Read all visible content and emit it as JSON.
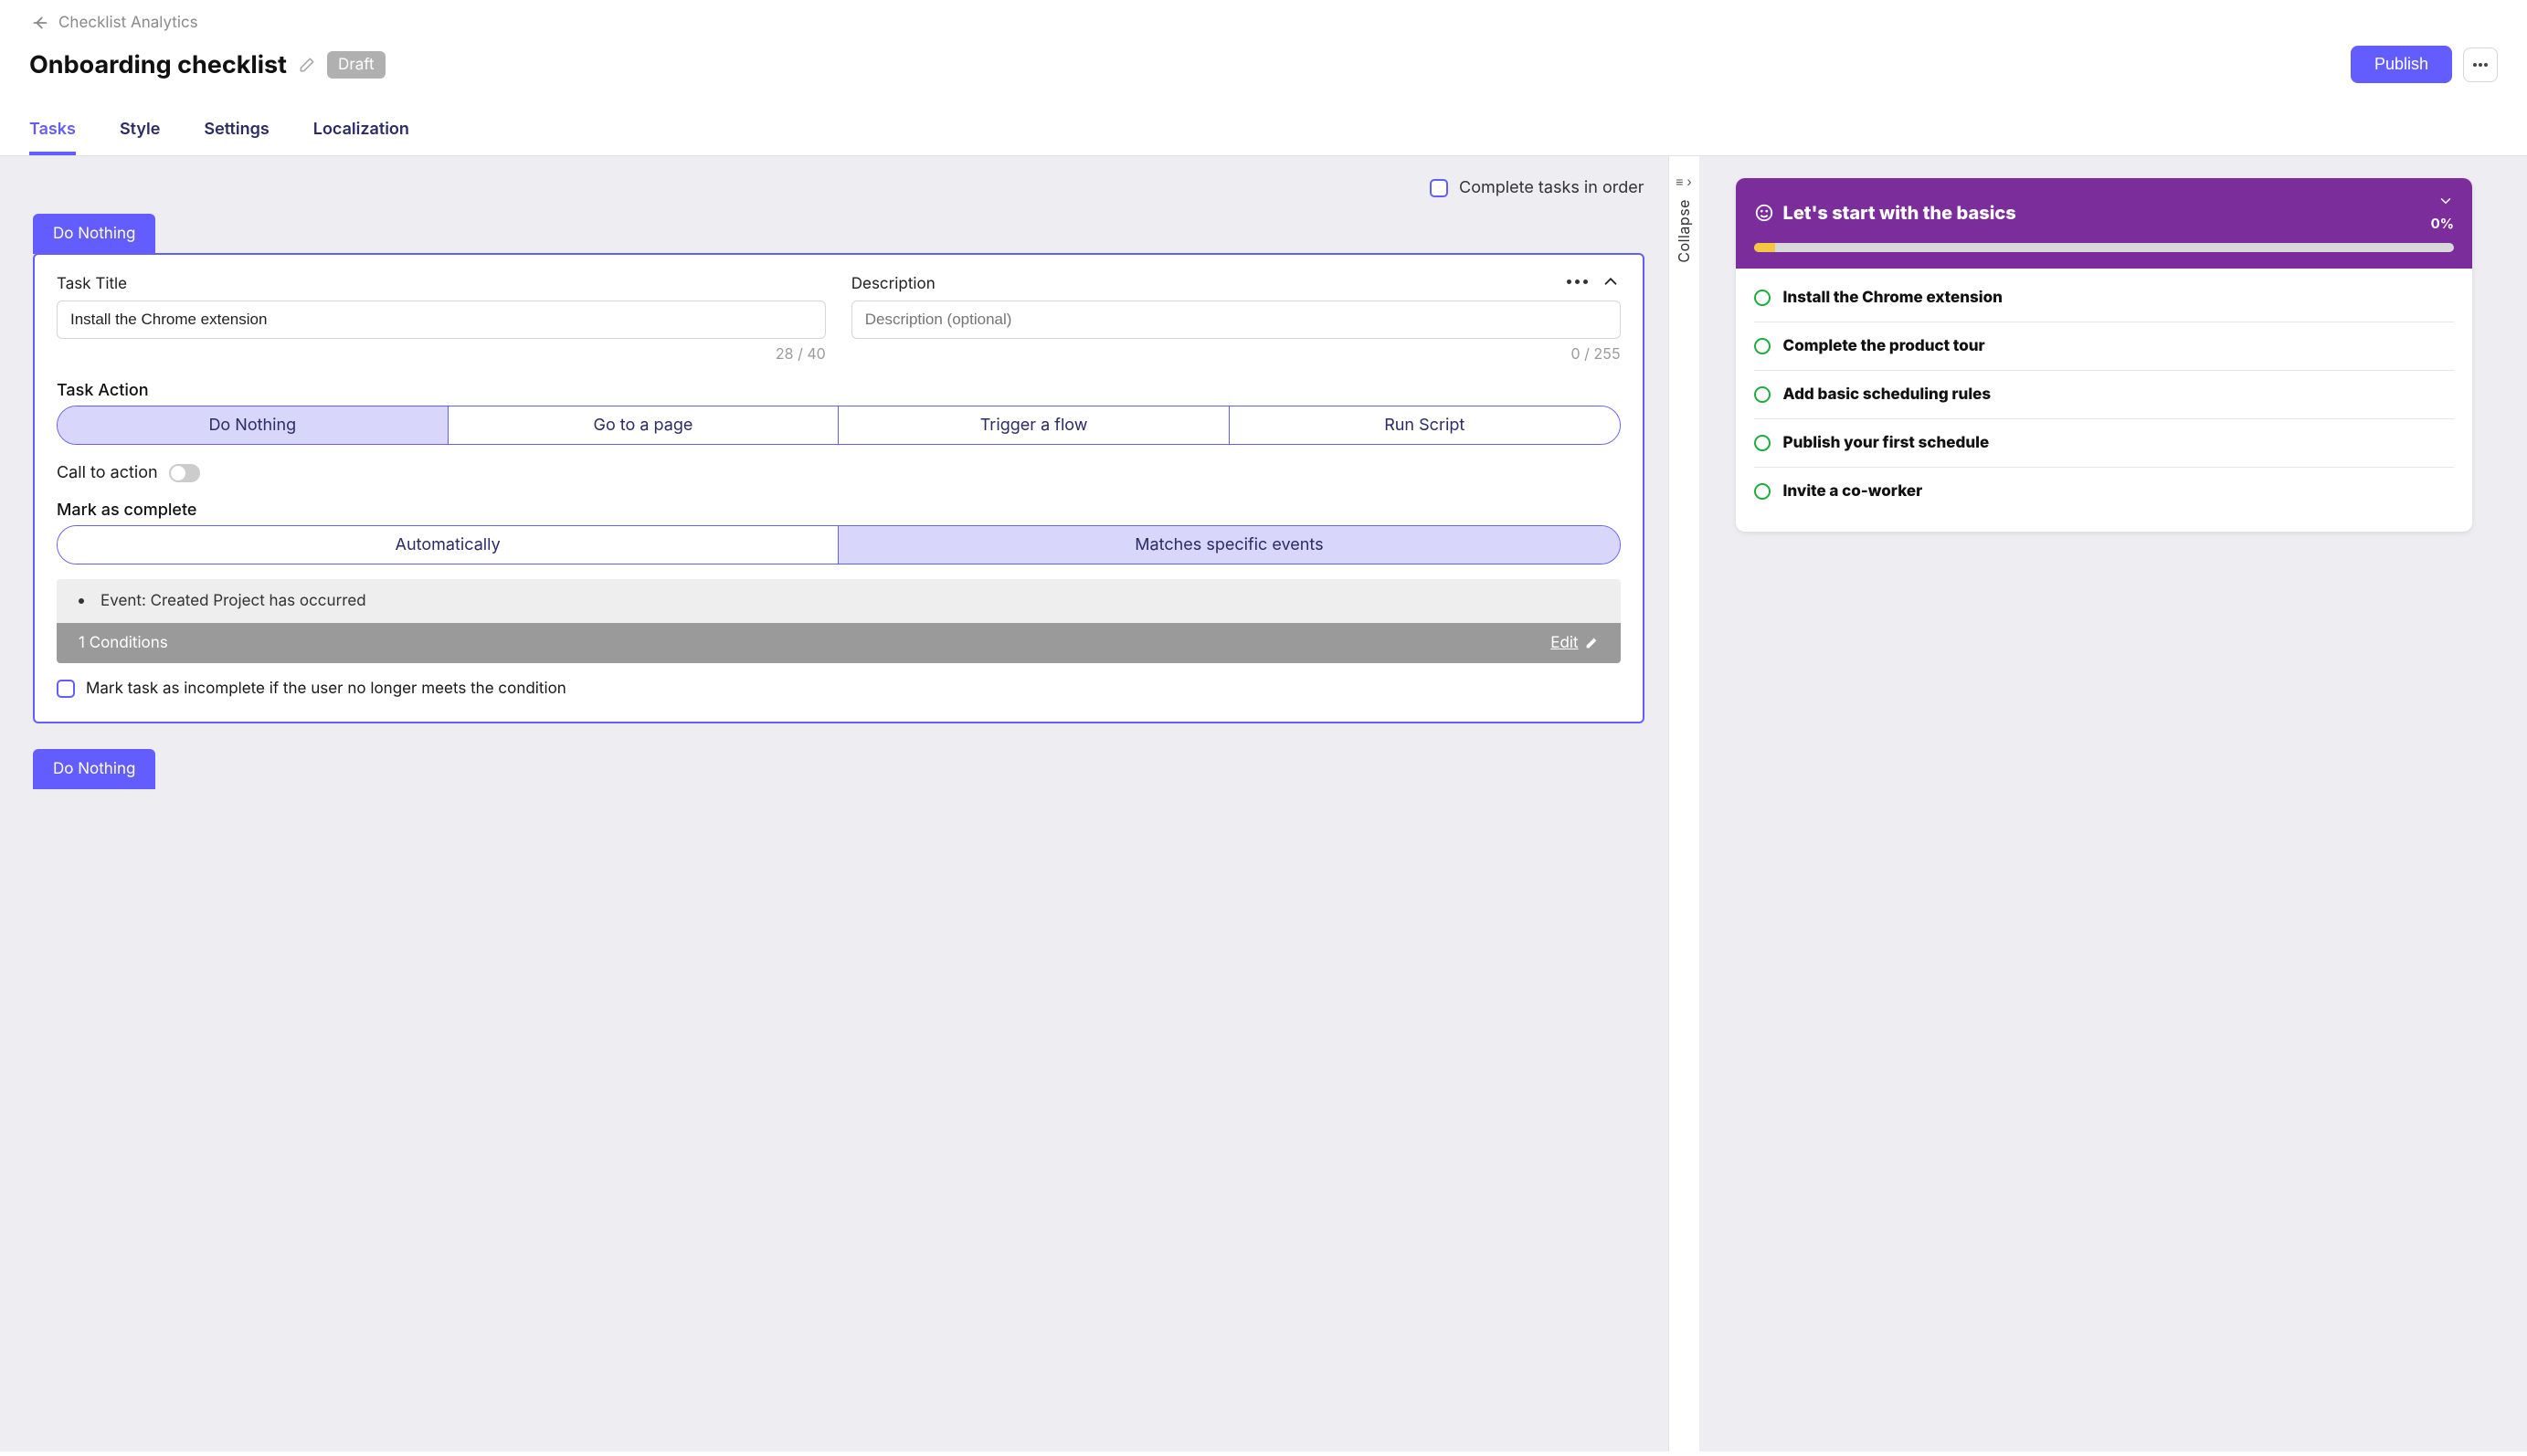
{
  "nav": {
    "back_label": "Checklist Analytics"
  },
  "header": {
    "title": "Onboarding checklist",
    "status": "Draft",
    "publish_label": "Publish"
  },
  "tabs": [
    "Tasks",
    "Style",
    "Settings",
    "Localization"
  ],
  "complete_in_order_label": "Complete tasks in order",
  "collapse_label": "Collapse",
  "task": {
    "tab_label": "Do Nothing",
    "title_label": "Task Title",
    "title_value": "Install the Chrome extension",
    "title_counter": "28 / 40",
    "desc_label": "Description",
    "desc_placeholder": "Description (optional)",
    "desc_counter": "0 / 255",
    "action_label": "Task Action",
    "action_options": [
      "Do Nothing",
      "Go to a page",
      "Trigger a flow",
      "Run Script"
    ],
    "cta_label": "Call to action",
    "mark_label": "Mark as complete",
    "mark_options": [
      "Automatically",
      "Matches specific events"
    ],
    "condition_line": "Event: Created Project has occurred",
    "conditions_count": "1 Conditions",
    "edit_label": "Edit",
    "incomplete_label": "Mark task as incomplete if the user no longer meets the condition"
  },
  "next_task_tab": "Do Nothing",
  "preview": {
    "title": "Let's start with the basics",
    "percent": "0%",
    "items": [
      "Install the Chrome extension",
      "Complete the product tour",
      "Add basic scheduling rules",
      "Publish your first schedule",
      "Invite a co-worker"
    ]
  }
}
